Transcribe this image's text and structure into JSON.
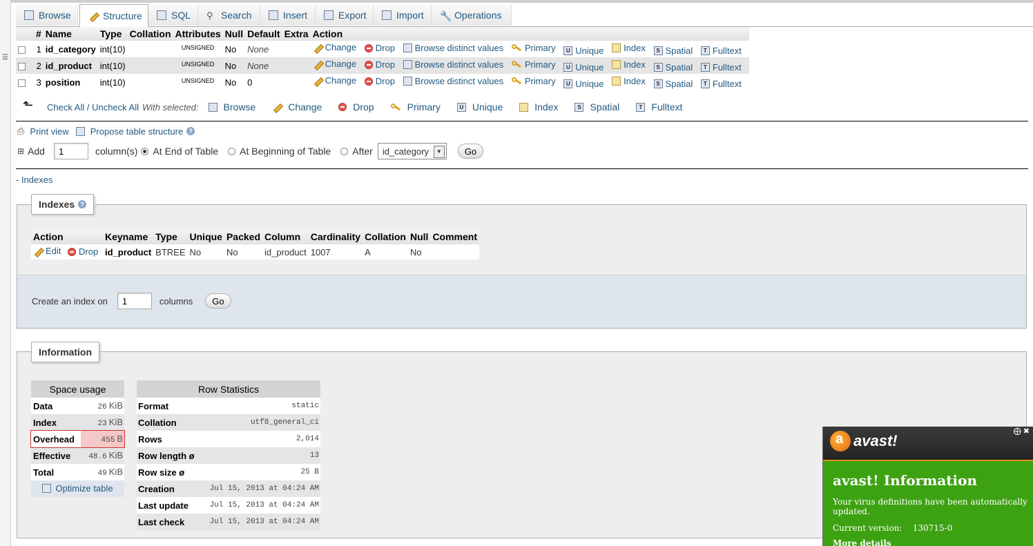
{
  "tabs": [
    {
      "label": "Browse",
      "icon": "browse-icon"
    },
    {
      "label": "Structure",
      "icon": "structure-icon"
    },
    {
      "label": "SQL",
      "icon": "sql-icon"
    },
    {
      "label": "Search",
      "icon": "search-icon"
    },
    {
      "label": "Insert",
      "icon": "insert-icon"
    },
    {
      "label": "Export",
      "icon": "export-icon"
    },
    {
      "label": "Import",
      "icon": "import-icon"
    },
    {
      "label": "Operations",
      "icon": "wrench-icon"
    }
  ],
  "structure": {
    "headers": [
      "#",
      "Name",
      "Type",
      "Collation",
      "Attributes",
      "Null",
      "Default",
      "Extra",
      "Action"
    ],
    "rows": [
      {
        "num": "1",
        "name": "id_category",
        "type": "int(10)",
        "collation": "",
        "attributes": "UNSIGNED",
        "null": "No",
        "default": "None",
        "extra": ""
      },
      {
        "num": "2",
        "name": "id_product",
        "type": "int(10)",
        "collation": "",
        "attributes": "UNSIGNED",
        "null": "No",
        "default": "None",
        "extra": ""
      },
      {
        "num": "3",
        "name": "position",
        "type": "int(10)",
        "collation": "",
        "attributes": "UNSIGNED",
        "null": "No",
        "default": "0",
        "extra": ""
      }
    ],
    "actions": {
      "change": "Change",
      "drop": "Drop",
      "browse_distinct": "Browse distinct values",
      "primary": "Primary",
      "unique": "Unique",
      "index": "Index",
      "spatial": "Spatial",
      "fulltext": "Fulltext"
    }
  },
  "with_selected": {
    "check_all": "Check All / Uncheck All",
    "label": "With selected:",
    "buttons": [
      "Browse",
      "Change",
      "Drop",
      "Primary",
      "Unique",
      "Index",
      "Spatial",
      "Fulltext"
    ]
  },
  "tools": {
    "print_view": "Print view",
    "propose": "Propose table structure"
  },
  "add_column": {
    "label": "Add",
    "count": "1",
    "columns_label": "column(s)",
    "at_end": "At End of Table",
    "at_beginning": "At Beginning of Table",
    "after": "After",
    "after_select": "id_category",
    "go": "Go"
  },
  "indexes_toggle": "- Indexes",
  "indexes": {
    "legend": "Indexes",
    "headers": [
      "Action",
      "Keyname",
      "Type",
      "Unique",
      "Packed",
      "Column",
      "Cardinality",
      "Collation",
      "Null",
      "Comment"
    ],
    "row": {
      "edit": "Edit",
      "drop": "Drop",
      "keyname": "id_product",
      "type": "BTREE",
      "unique": "No",
      "packed": "No",
      "column": "id_product",
      "cardinality": "1007",
      "collation": "A",
      "null": "No",
      "comment": ""
    },
    "create_label": "Create an index on",
    "create_count": "1",
    "create_columns": "columns",
    "go": "Go"
  },
  "information": {
    "legend": "Information",
    "space_usage": {
      "title": "Space usage",
      "rows": [
        {
          "label": "Data",
          "value": "26",
          "unit": "KiB"
        },
        {
          "label": "Index",
          "value": "23",
          "unit": "KiB"
        },
        {
          "label": "Overhead",
          "value": "455",
          "unit": "B"
        },
        {
          "label": "Effective",
          "value": "48.6",
          "unit": "KiB"
        },
        {
          "label": "Total",
          "value": "49",
          "unit": "KiB"
        }
      ],
      "optimize": "Optimize table"
    },
    "row_statistics": {
      "title": "Row Statistics",
      "rows": [
        {
          "label": "Format",
          "value": "static"
        },
        {
          "label": "Collation",
          "value": "utf8_general_ci"
        },
        {
          "label": "Rows",
          "value": "2,014"
        },
        {
          "label": "Row length ø",
          "value": "13"
        },
        {
          "label": "Row size ø",
          "value": "25 B"
        },
        {
          "label": "Creation",
          "value": "Jul 15, 2013 at 04:24 AM"
        },
        {
          "label": "Last update",
          "value": "Jul 15, 2013 at 04:24 AM"
        },
        {
          "label": "Last check",
          "value": "Jul 15, 2013 at 04:24 AM"
        }
      ]
    }
  },
  "avast": {
    "brand": "avast!",
    "title": "avast! Information",
    "message": "Your virus definitions have been automatically updated.",
    "version_label": "Current version:",
    "version": "130715-0",
    "more": "More details",
    "colors": {
      "header": "#2d2d2d",
      "body": "#3da212",
      "accent": "#e98b18"
    }
  },
  "colors": {
    "link": "#235a81",
    "row_alt": "#e5e5e5",
    "overhead_highlight": "#f6c7c7"
  }
}
